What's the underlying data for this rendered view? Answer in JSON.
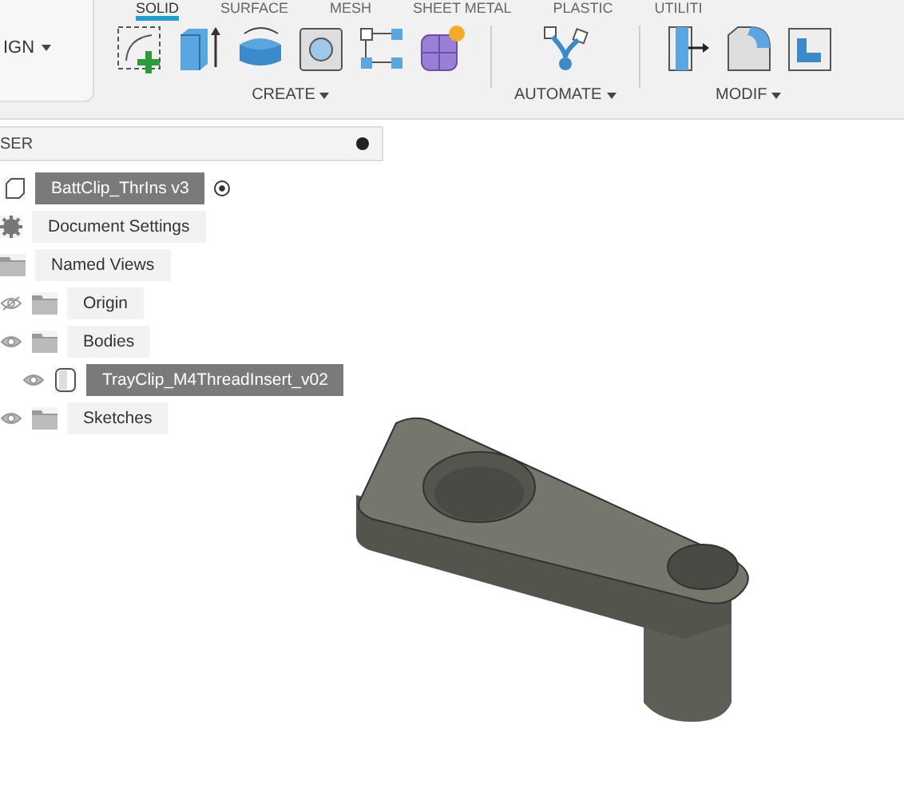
{
  "workspace_button": {
    "label": "IGN"
  },
  "tabs": [
    {
      "label": "SOLID",
      "selected": true
    },
    {
      "label": "SURFACE",
      "selected": false
    },
    {
      "label": "MESH",
      "selected": false
    },
    {
      "label": "SHEET METAL",
      "selected": false
    },
    {
      "label": "PLASTIC",
      "selected": false
    },
    {
      "label": "UTILITI",
      "selected": false
    }
  ],
  "toolbar_groups": [
    {
      "label": "CREATE",
      "tools": [
        {
          "kind": "sketch"
        },
        {
          "kind": "extrude"
        },
        {
          "kind": "revolve"
        },
        {
          "kind": "hole"
        },
        {
          "kind": "pattern"
        },
        {
          "kind": "form"
        }
      ]
    },
    {
      "label": "AUTOMATE",
      "tools": [
        {
          "kind": "automate"
        }
      ]
    },
    {
      "label": "MODIF",
      "tools": [
        {
          "kind": "presspull"
        },
        {
          "kind": "fillet"
        },
        {
          "kind": "shell"
        }
      ]
    }
  ],
  "browser": {
    "title": "SER",
    "root": {
      "label": "BattClip_ThrIns v3",
      "selected": true,
      "active": true
    },
    "items": [
      {
        "kind": "settings",
        "label": "Document Settings",
        "selected": false
      },
      {
        "kind": "folder",
        "label": "Named Views",
        "selected": false
      },
      {
        "kind": "folder",
        "label": "Origin",
        "visible": false,
        "selected": false
      },
      {
        "kind": "folder",
        "label": "Bodies",
        "visible": true,
        "selected": false,
        "children": [
          {
            "kind": "body",
            "label": "TrayClip_M4ThreadInsert_v02",
            "visible": true,
            "selected": true
          }
        ]
      },
      {
        "kind": "folder",
        "label": "Sketches",
        "visible": true,
        "selected": false
      }
    ]
  }
}
